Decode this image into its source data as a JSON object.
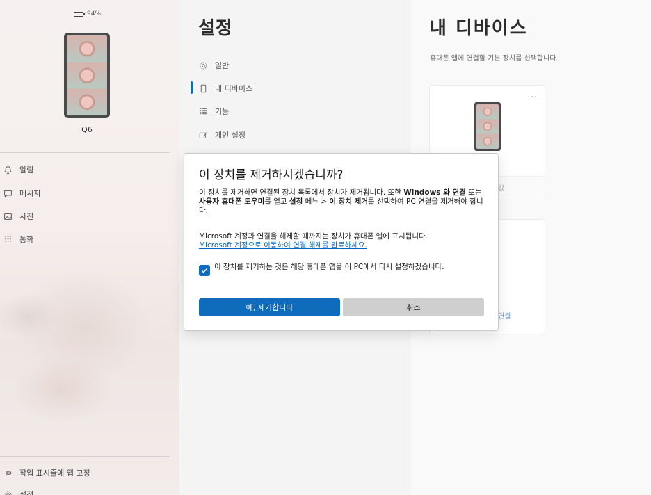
{
  "left": {
    "battery_text": "94%",
    "battery_level": 0.94,
    "device_name": "Q6",
    "nav": [
      {
        "label": "알림",
        "icon": "bell-icon"
      },
      {
        "label": "메시지",
        "icon": "chat-icon"
      },
      {
        "label": "사진",
        "icon": "photo-icon"
      },
      {
        "label": "통화",
        "icon": "dialpad-icon"
      }
    ],
    "pin_label": "작업 표시줄에 앱 고정",
    "settings_label": "설정"
  },
  "middle": {
    "title": "설정",
    "menu": [
      {
        "label": "일반",
        "icon": "gear-icon"
      },
      {
        "label": "내 디바이스",
        "icon": "phone-icon",
        "active": true
      },
      {
        "label": "기능",
        "icon": "list-icon"
      },
      {
        "label": "개인 설정",
        "icon": "brush-icon"
      }
    ]
  },
  "right": {
    "title": "내 디바이스",
    "subtitle": "휴대폰 앱에 연결할 기본 장치를 선택합니다.",
    "card1_more": "...",
    "card1_fragment": "값",
    "card2_fragment": "연결"
  },
  "dialog": {
    "title": "이 장치를 제거하시겠습니까?",
    "para1_a": "이 장치를 제거하면 연결된 장치 목록에서 장치가 제거됩니다. 또한 ",
    "para1_b": "Windows 와 연결",
    "para1_c": " 또는 ",
    "para1_d": "사용자 휴대폰 도우미",
    "para1_e": "를 열고 ",
    "para1_f": "설정",
    "para1_g": " 메뉴 > ",
    "para1_h": "이 장치 제거",
    "para1_i": "를 선택하여 PC 연결을 제거해야 합니다.",
    "para2": "Microsoft 계정과 연결을 해제할 때까지는 장치가 휴대폰 앱에 표시됩니다.",
    "link": "Microsoft 계정으로 이동하여 연결 해제를 완료하세요.",
    "checkbox_label": "이 장치를 제거하는 것은 해당 휴대폰 앱을 이 PC에서 다시 설정하겠습니다.",
    "checkbox_checked": true,
    "confirm_label": "예, 제거합니다",
    "cancel_label": "취소"
  },
  "colors": {
    "accent": "#0f6cbd",
    "link": "#0067c0",
    "cancel_bg": "#cfcfcf"
  }
}
